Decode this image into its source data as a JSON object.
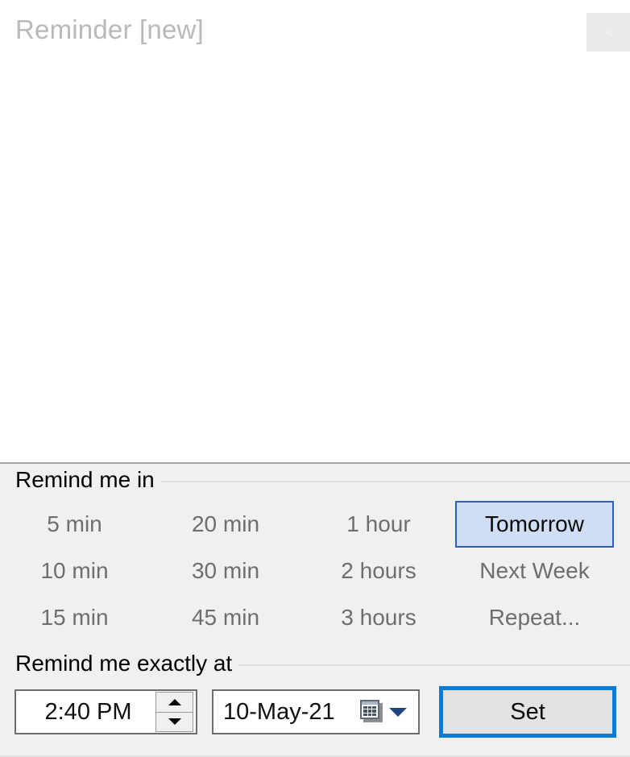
{
  "window": {
    "title": "Reminder [new]",
    "close_label": "×",
    "close_icon": "close-icon"
  },
  "content": {
    "body_text": ""
  },
  "remind_in": {
    "group_label": "Remind me in",
    "options": [
      {
        "label": "5 min",
        "state": "normal"
      },
      {
        "label": "20 min",
        "state": "normal"
      },
      {
        "label": "1 hour",
        "state": "normal"
      },
      {
        "label": "Tomorrow",
        "state": "hovered"
      },
      {
        "label": "10 min",
        "state": "normal"
      },
      {
        "label": "30 min",
        "state": "normal"
      },
      {
        "label": "2 hours",
        "state": "normal"
      },
      {
        "label": "Next Week",
        "state": "normal"
      },
      {
        "label": "15 min",
        "state": "normal"
      },
      {
        "label": "45 min",
        "state": "normal"
      },
      {
        "label": "3 hours",
        "state": "normal"
      },
      {
        "label": "Repeat...",
        "state": "normal"
      }
    ]
  },
  "remind_exactly": {
    "group_label": "Remind me exactly at",
    "time_value": "2:40 PM",
    "date_value": "10-May-21",
    "calendar_icon": "calendar-icon",
    "dropdown_icon": "chevron-down-icon",
    "spinner_up_icon": "arrow-up-icon",
    "spinner_down_icon": "arrow-down-icon",
    "set_label": "Set"
  },
  "colors": {
    "panel_background": "#f0f0f0",
    "content_background": "#ffffff",
    "title_text": "#b8b8bd",
    "option_text": "#6d6d72",
    "hover_fill": "#cfdef4",
    "hover_border": "#2b60ba",
    "focus_border": "#0a7bd4",
    "field_border": "#6e6e6e",
    "rule": "#dcdcdc"
  }
}
